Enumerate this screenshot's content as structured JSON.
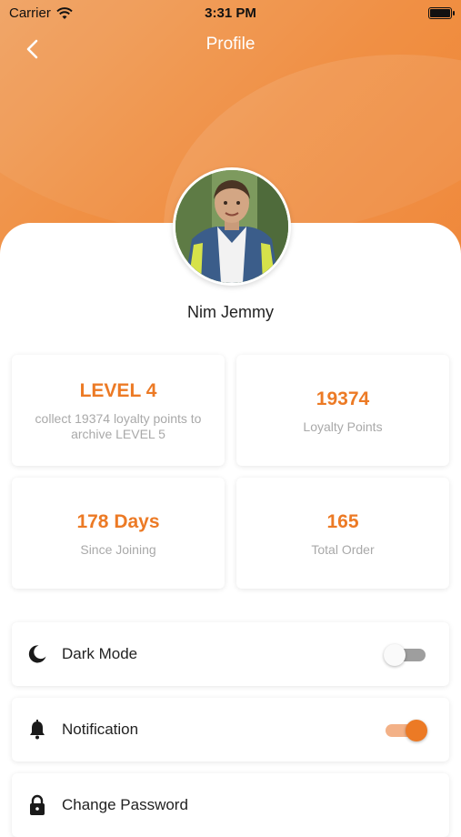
{
  "status_bar": {
    "carrier": "Carrier",
    "time": "3:31 PM"
  },
  "header": {
    "title": "Profile",
    "accent_color": "#ec7a25"
  },
  "profile": {
    "name": "Nim Jemmy"
  },
  "stats": [
    {
      "value": "LEVEL 4",
      "label": "collect 19374 loyalty points to archive LEVEL 5"
    },
    {
      "value": "19374",
      "label": "Loyalty Points"
    },
    {
      "value": "178 Days",
      "label": "Since Joining"
    },
    {
      "value": "165",
      "label": "Total Order"
    }
  ],
  "settings": [
    {
      "label": "Dark Mode",
      "icon": "moon-icon",
      "toggle": "off"
    },
    {
      "label": "Notification",
      "icon": "bell-icon",
      "toggle": "on"
    },
    {
      "label": "Change Password",
      "icon": "lock-icon"
    }
  ]
}
